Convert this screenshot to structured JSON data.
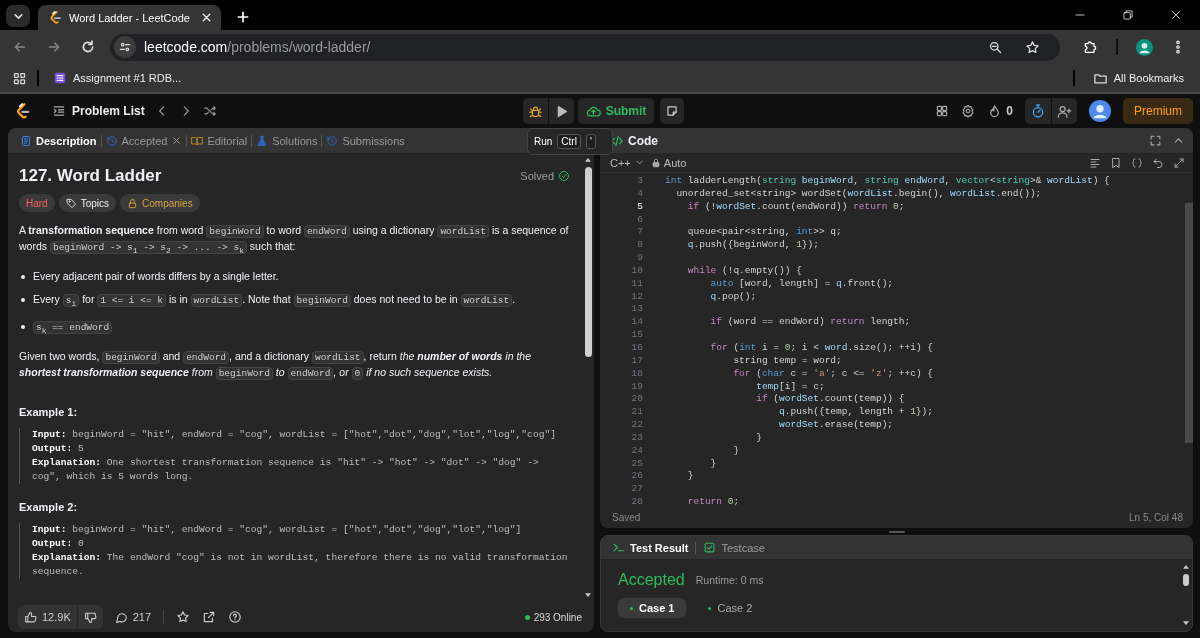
{
  "browser": {
    "tabs": [
      {
        "title": "Word Ladder - LeetCode",
        "selected": true
      }
    ],
    "address": {
      "domain": "leetcode.com",
      "path": "/problems/word-ladder/"
    },
    "bookmarks": [
      {
        "label": "Assignment #1 RDB..."
      }
    ],
    "all_bookmarks": "All Bookmarks"
  },
  "nav": {
    "problem_list": "Problem List",
    "submit": "Submit",
    "streak": "0",
    "premium": "Premium"
  },
  "tooltip": {
    "label": "Run",
    "keys": [
      "Ctrl",
      "'"
    ]
  },
  "description_panel": {
    "tabs": [
      {
        "label": "Description",
        "kind": "description",
        "selected": true,
        "closable": false
      },
      {
        "label": "Accepted",
        "kind": "accepted",
        "selected": false,
        "closable": true
      },
      {
        "label": "Editorial",
        "kind": "editorial",
        "selected": false,
        "closable": false
      },
      {
        "label": "Solutions",
        "kind": "solutions",
        "selected": false,
        "closable": false
      },
      {
        "label": "Submissions",
        "kind": "submissions",
        "selected": false,
        "closable": false
      }
    ],
    "title": "127. Word Ladder",
    "status": "Solved",
    "tags": [
      {
        "label": "Hard",
        "kind": "difficulty"
      },
      {
        "label": "Topics",
        "kind": "topics"
      },
      {
        "label": "Companies",
        "kind": "companies"
      }
    ],
    "intro": [
      {
        "kind": "text",
        "text": "A **transformation sequence** from word "
      },
      {
        "kind": "code",
        "text": "beginWord"
      },
      {
        "kind": "text",
        "text": " to word "
      },
      {
        "kind": "code",
        "text": "endWord"
      },
      {
        "kind": "text",
        "text": " using a dictionary "
      },
      {
        "kind": "code",
        "text": "wordList"
      },
      {
        "kind": "text",
        "text": " is a sequence of words "
      },
      {
        "kind": "code",
        "text": "beginWord -> s$_{1}$ -> s$_{2}$ -> ... -> s$_{k}$"
      },
      {
        "kind": "text",
        "text": " such that:"
      }
    ],
    "bullets": [
      [
        {
          "kind": "text",
          "text": "Every adjacent pair of words differs by a single letter."
        }
      ],
      [
        {
          "kind": "text",
          "text": "Every "
        },
        {
          "kind": "code",
          "text": "s$_{i}$"
        },
        {
          "kind": "text",
          "text": " for "
        },
        {
          "kind": "code",
          "text": "1 <= i <= k"
        },
        {
          "kind": "text",
          "text": " is in "
        },
        {
          "kind": "code",
          "text": "wordList"
        },
        {
          "kind": "text",
          "text": ". Note that "
        },
        {
          "kind": "code",
          "text": "beginWord"
        },
        {
          "kind": "text",
          "text": " does not need to be in "
        },
        {
          "kind": "code",
          "text": "wordList"
        },
        {
          "kind": "text",
          "text": "."
        }
      ],
      [
        {
          "kind": "code",
          "text": "s$_{k}$ == endWord"
        }
      ]
    ],
    "task": [
      {
        "kind": "text",
        "text": "Given two words, "
      },
      {
        "kind": "code",
        "text": "beginWord"
      },
      {
        "kind": "text",
        "text": " and "
      },
      {
        "kind": "code",
        "text": "endWord"
      },
      {
        "kind": "text",
        "text": ", and a dictionary "
      },
      {
        "kind": "code",
        "text": "wordList"
      },
      {
        "kind": "text",
        "text": ", return "
      },
      {
        "kind": "italic",
        "text": "the **number of words** in the **shortest transformation sequence** from "
      },
      {
        "kind": "code",
        "text": "beginWord"
      },
      {
        "kind": "italic",
        "text": " to "
      },
      {
        "kind": "code",
        "text": "endWord"
      },
      {
        "kind": "italic",
        "text": ", or "
      },
      {
        "kind": "code",
        "text": "0"
      },
      {
        "kind": "italic",
        "text": " if no such sequence exists."
      }
    ],
    "examples": [
      {
        "title": "Example 1:",
        "lines": [
          "**Input:** beginWord = \"hit\", endWord = \"cog\", wordList = [\"hot\",\"dot\",\"dog\",\"lot\",\"log\",\"cog\"]",
          "**Output:** 5",
          "**Explanation:** One shortest transformation sequence is \"hit\" -> \"hot\" -> \"dot\" -> \"dog\" -> cog\", which is 5 words long."
        ]
      },
      {
        "title": "Example 2:",
        "lines": [
          "**Input:** beginWord = \"hit\", endWord = \"cog\", wordList = [\"hot\",\"dot\",\"dog\",\"lot\",\"log\"]",
          "**Output:** 0",
          "**Explanation:** The endWord \"cog\" is not in wordList, therefore there is no valid transformation sequence."
        ]
      }
    ],
    "footer": {
      "likes": "12.9K",
      "comments": "217",
      "online": "293 Online"
    }
  },
  "editor": {
    "title": "Code",
    "language": "C++",
    "mode": "Auto",
    "status": "Saved",
    "cursor": "Ln 5, Col 48",
    "lines": [
      {
        "number": "3",
        "current": false,
        "tokens": [
          {
            "kind": "type",
            "text": "int"
          },
          {
            "kind": "plain",
            "text": " ladderLength("
          },
          {
            "kind": "cls",
            "text": "string"
          },
          {
            "kind": "var",
            "text": " beginWord"
          },
          {
            "kind": "plain",
            "text": ", "
          },
          {
            "kind": "cls",
            "text": "string"
          },
          {
            "kind": "var",
            "text": " endWord"
          },
          {
            "kind": "plain",
            "text": ", "
          },
          {
            "kind": "cls",
            "text": "vector"
          },
          {
            "kind": "plain",
            "text": "<"
          },
          {
            "kind": "cls",
            "text": "string"
          },
          {
            "kind": "plain",
            "text": ">& "
          },
          {
            "kind": "var",
            "text": "wordList"
          },
          {
            "kind": "plain",
            "text": ") {"
          }
        ]
      },
      {
        "number": "4",
        "current": false,
        "tokens": [
          {
            "kind": "plain",
            "text": "  unordered_set<string> wordSet("
          },
          {
            "kind": "var",
            "text": "wordList"
          },
          {
            "kind": "plain",
            "text": ".begin(), "
          },
          {
            "kind": "var",
            "text": "wordList"
          },
          {
            "kind": "plain",
            "text": ".end());"
          }
        ]
      },
      {
        "number": "5",
        "current": true,
        "tokens": [
          {
            "kind": "kw",
            "text": "    if"
          },
          {
            "kind": "plain",
            "text": " (!"
          },
          {
            "kind": "var",
            "text": "wordSet"
          },
          {
            "kind": "plain",
            "text": ".count(endWord)) "
          },
          {
            "kind": "kw",
            "text": "return"
          },
          {
            "kind": "num",
            "text": " 0"
          },
          {
            "kind": "plain",
            "text": ";"
          }
        ]
      },
      {
        "number": "6",
        "current": false
      },
      {
        "number": "7",
        "current": false,
        "tokens": [
          {
            "kind": "plain",
            "text": "    queue<pair<string, "
          },
          {
            "kind": "type",
            "text": "int"
          },
          {
            "kind": "plain",
            "text": ">> q;"
          }
        ]
      },
      {
        "number": "8",
        "current": false,
        "tokens": [
          {
            "kind": "var",
            "text": "    q"
          },
          {
            "kind": "plain",
            "text": ".push({beginWord, "
          },
          {
            "kind": "num",
            "text": "1"
          },
          {
            "kind": "plain",
            "text": "});"
          }
        ]
      },
      {
        "number": "9",
        "current": false
      },
      {
        "number": "10",
        "current": false,
        "tokens": [
          {
            "kind": "kw",
            "text": "    while"
          },
          {
            "kind": "plain",
            "text": " (!q.empty()) {"
          }
        ]
      },
      {
        "number": "11",
        "current": false,
        "tokens": [
          {
            "kind": "type",
            "text": "        auto"
          },
          {
            "kind": "plain",
            "text": " [word, length] = "
          },
          {
            "kind": "var",
            "text": "q"
          },
          {
            "kind": "plain",
            "text": ".front();"
          }
        ]
      },
      {
        "number": "12",
        "current": false,
        "tokens": [
          {
            "kind": "var",
            "text": "        q"
          },
          {
            "kind": "plain",
            "text": ".pop();"
          }
        ]
      },
      {
        "number": "13",
        "current": false
      },
      {
        "number": "14",
        "current": false,
        "tokens": [
          {
            "kind": "kw",
            "text": "        if"
          },
          {
            "kind": "plain",
            "text": " (word == endWord) "
          },
          {
            "kind": "kw",
            "text": "return"
          },
          {
            "kind": "plain",
            "text": " length;"
          }
        ]
      },
      {
        "number": "15",
        "current": false
      },
      {
        "number": "16",
        "current": false,
        "tokens": [
          {
            "kind": "kw",
            "text": "        for"
          },
          {
            "kind": "plain",
            "text": " ("
          },
          {
            "kind": "type",
            "text": "int"
          },
          {
            "kind": "plain",
            "text": " i = "
          },
          {
            "kind": "num",
            "text": "0"
          },
          {
            "kind": "plain",
            "text": "; i < "
          },
          {
            "kind": "var",
            "text": "word"
          },
          {
            "kind": "plain",
            "text": ".size(); ++i) {"
          }
        ]
      },
      {
        "number": "17",
        "current": false,
        "tokens": [
          {
            "kind": "plain",
            "text": "            string temp = word;"
          }
        ]
      },
      {
        "number": "18",
        "current": false,
        "tokens": [
          {
            "kind": "kw",
            "text": "            for"
          },
          {
            "kind": "plain",
            "text": " ("
          },
          {
            "kind": "type",
            "text": "char"
          },
          {
            "kind": "plain",
            "text": " c = "
          },
          {
            "kind": "str",
            "text": "'a'"
          },
          {
            "kind": "plain",
            "text": "; c <= "
          },
          {
            "kind": "str",
            "text": "'z'"
          },
          {
            "kind": "plain",
            "text": "; ++c) {"
          }
        ]
      },
      {
        "number": "19",
        "current": false,
        "tokens": [
          {
            "kind": "var",
            "text": "                temp"
          },
          {
            "kind": "plain",
            "text": "[i] = c;"
          }
        ]
      },
      {
        "number": "20",
        "current": false,
        "tokens": [
          {
            "kind": "kw",
            "text": "                if"
          },
          {
            "kind": "plain",
            "text": " ("
          },
          {
            "kind": "var",
            "text": "wordSet"
          },
          {
            "kind": "plain",
            "text": ".count(temp)) {"
          }
        ]
      },
      {
        "number": "21",
        "current": false,
        "tokens": [
          {
            "kind": "var",
            "text": "                    q"
          },
          {
            "kind": "plain",
            "text": ".push({temp, length + "
          },
          {
            "kind": "num",
            "text": "1"
          },
          {
            "kind": "plain",
            "text": "});"
          }
        ]
      },
      {
        "number": "22",
        "current": false,
        "tokens": [
          {
            "kind": "var",
            "text": "                    wordSet"
          },
          {
            "kind": "plain",
            "text": ".erase(temp);"
          }
        ]
      },
      {
        "number": "23",
        "current": false,
        "tokens": [
          {
            "kind": "plain",
            "text": "                }"
          }
        ]
      },
      {
        "number": "24",
        "current": false,
        "tokens": [
          {
            "kind": "plain",
            "text": "            }"
          }
        ]
      },
      {
        "number": "25",
        "current": false,
        "tokens": [
          {
            "kind": "plain",
            "text": "        }"
          }
        ]
      },
      {
        "number": "26",
        "current": false,
        "tokens": [
          {
            "kind": "plain",
            "text": "    }"
          }
        ]
      },
      {
        "number": "27",
        "current": false
      },
      {
        "number": "28",
        "current": false,
        "tokens": [
          {
            "kind": "kw",
            "text": "    return"
          },
          {
            "kind": "num",
            "text": " 0"
          },
          {
            "kind": "plain",
            "text": ";"
          }
        ]
      }
    ]
  },
  "test_result": {
    "tabs": [
      {
        "label": "Test Result",
        "kind": "result",
        "selected": true
      },
      {
        "label": "Testcase",
        "kind": "testcase",
        "selected": false
      }
    ],
    "verdict": "Accepted",
    "runtime": "Runtime: 0 ms",
    "cases": [
      {
        "label": "Case 1",
        "selected": true
      },
      {
        "label": "Case 2",
        "selected": false
      }
    ]
  }
}
